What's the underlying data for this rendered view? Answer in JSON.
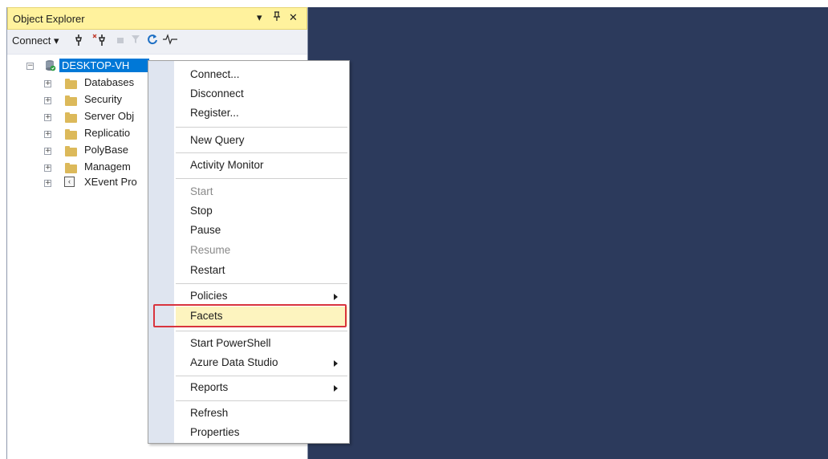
{
  "object_explorer": {
    "title": "Object Explorer",
    "controls": {
      "dropdown": "▾",
      "pin": "ᵖ",
      "close": "✕"
    },
    "toolbar": {
      "connect_label": "Connect ▾"
    },
    "server_node": {
      "label": "DESKTOP-VH",
      "expander": "−"
    },
    "tree": [
      {
        "label": "Databases",
        "expander": "+"
      },
      {
        "label": "Security",
        "expander": "+"
      },
      {
        "label": "Server Obj",
        "expander": "+"
      },
      {
        "label": "Replicatio",
        "expander": "+"
      },
      {
        "label": "PolyBase",
        "expander": "+"
      },
      {
        "label": "Managem",
        "expander": "+"
      },
      {
        "label": "XEvent Pro",
        "expander": "+"
      }
    ]
  },
  "context_menu": {
    "items": [
      {
        "label": "Connect...",
        "enabled": true
      },
      {
        "label": "Disconnect",
        "enabled": true
      },
      {
        "label": "Register...",
        "enabled": true
      },
      {
        "label": "New Query",
        "enabled": true
      },
      {
        "label": "Activity Monitor",
        "enabled": true
      },
      {
        "label": "Start",
        "enabled": false
      },
      {
        "label": "Stop",
        "enabled": true
      },
      {
        "label": "Pause",
        "enabled": true
      },
      {
        "label": "Resume",
        "enabled": false
      },
      {
        "label": "Restart",
        "enabled": true
      },
      {
        "label": "Policies",
        "enabled": true,
        "submenu": true
      },
      {
        "label": "Facets",
        "enabled": true,
        "highlighted": true
      },
      {
        "label": "Start PowerShell",
        "enabled": true
      },
      {
        "label": "Azure Data Studio",
        "enabled": true,
        "submenu": true
      },
      {
        "label": "Reports",
        "enabled": true,
        "submenu": true
      },
      {
        "label": "Refresh",
        "enabled": true
      },
      {
        "label": "Properties",
        "enabled": true
      }
    ]
  },
  "colors": {
    "main_background": "#2c3a5c",
    "title_bar": "#fff29d",
    "selection": "#0078d7",
    "highlight_box": "#d9343e"
  }
}
